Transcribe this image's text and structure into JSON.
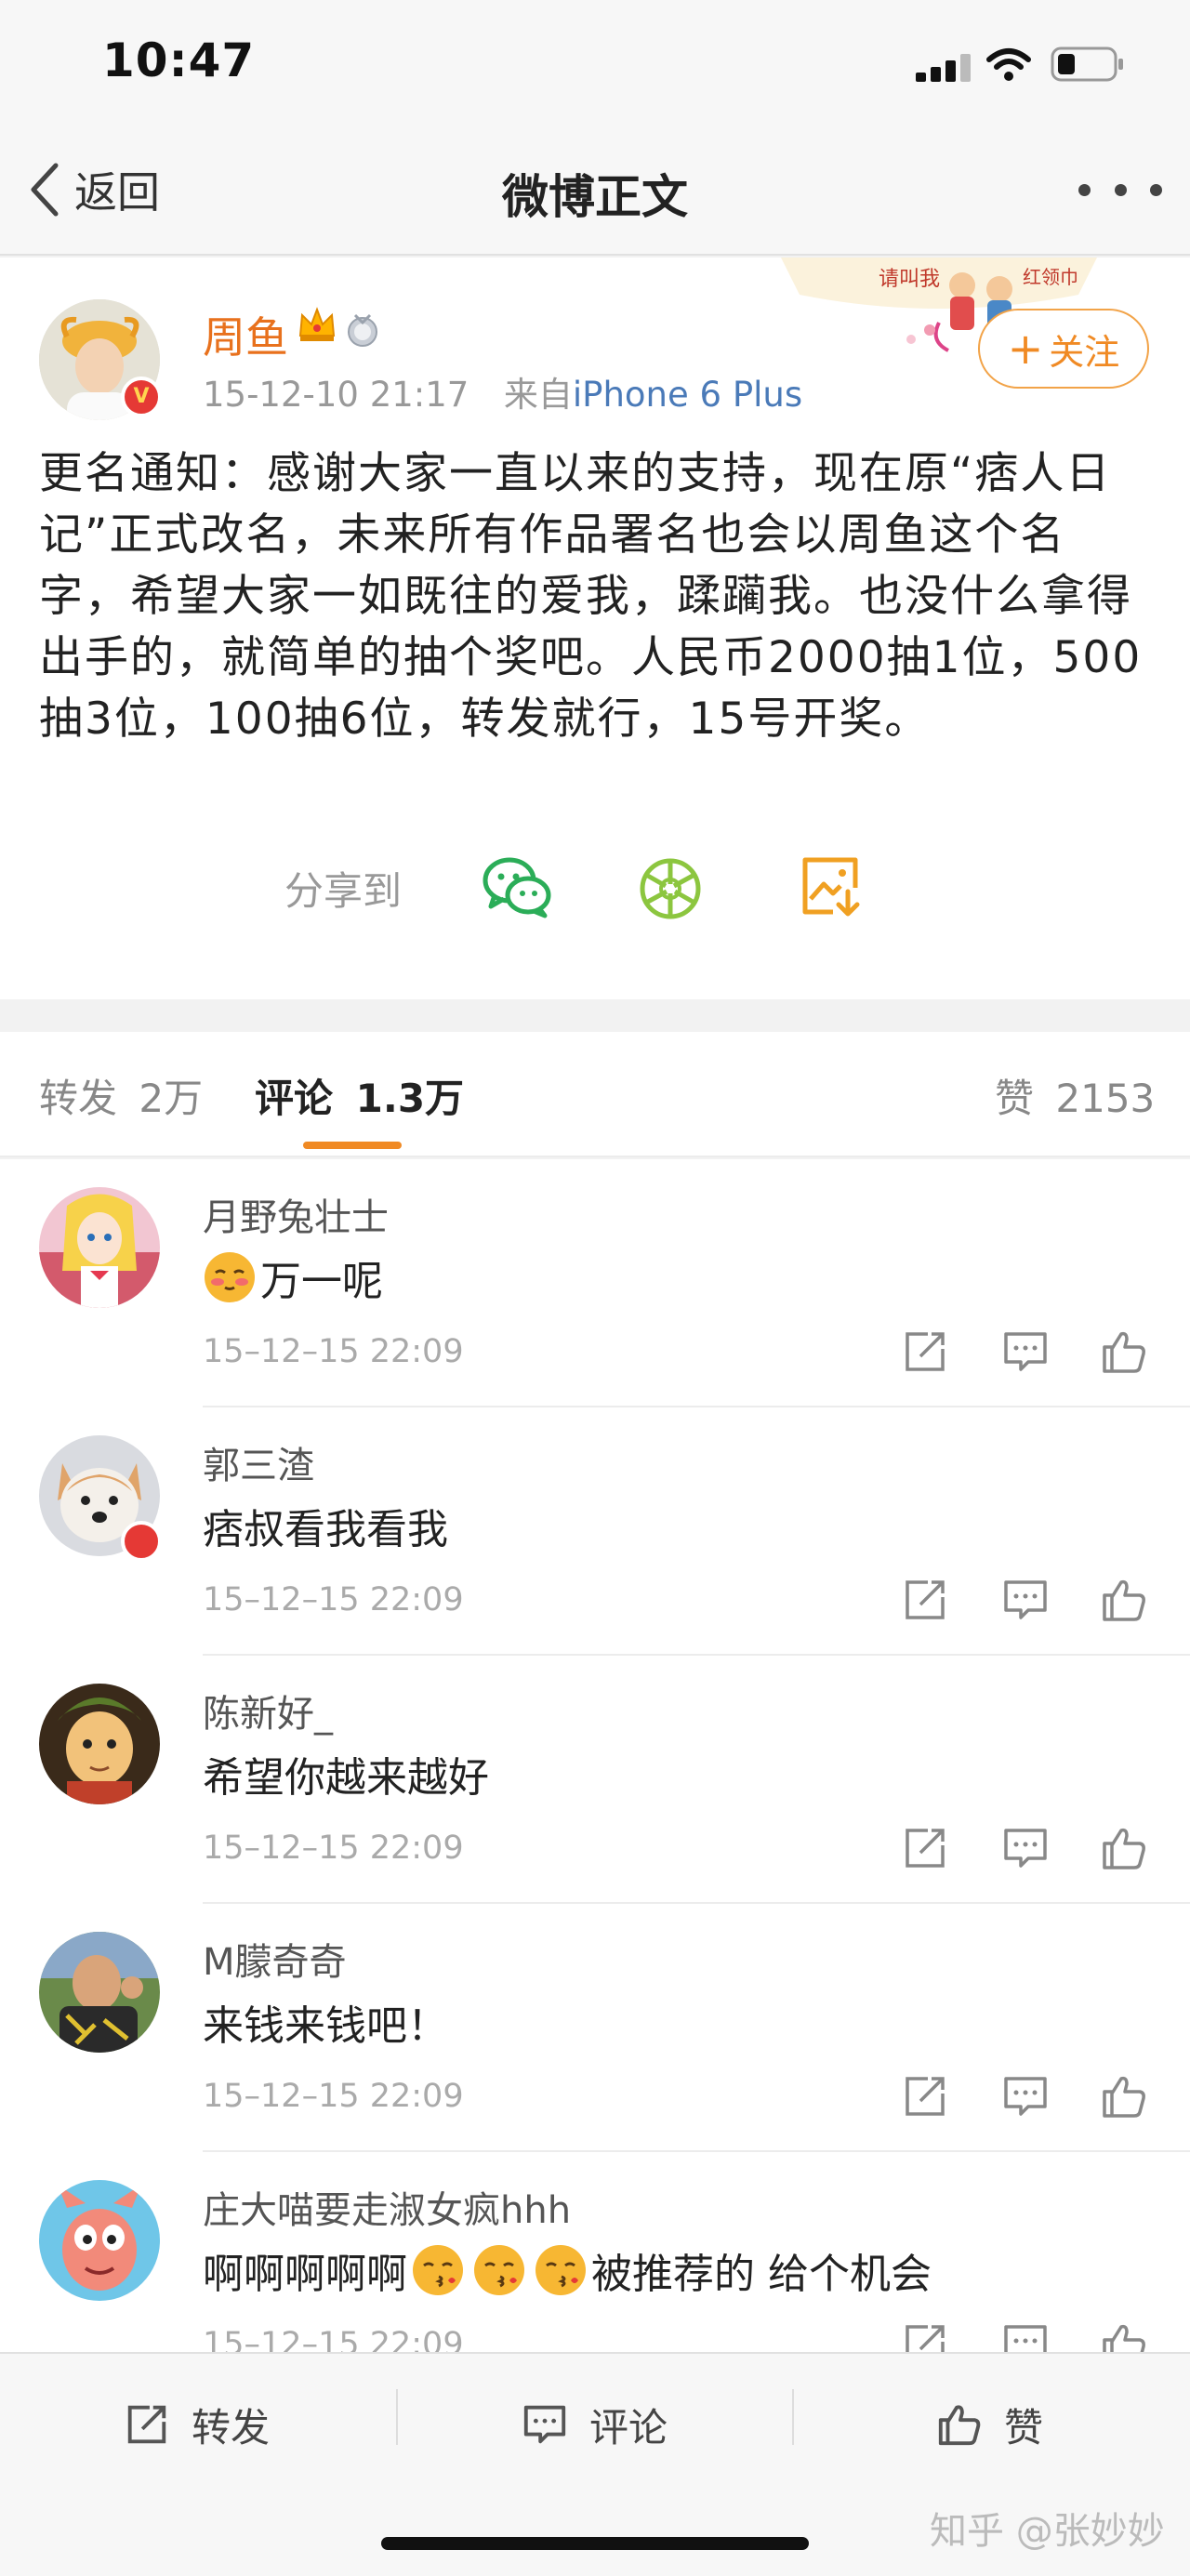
{
  "status_bar": {
    "time": "10:47"
  },
  "nav": {
    "back_label": "返回",
    "title": "微博正文"
  },
  "post": {
    "author": "周鱼",
    "date": "15-12-10 21:17",
    "source_prefix": "来自",
    "source": "iPhone 6 Plus",
    "follow_label": "关注",
    "text": "更名通知：感谢大家一直以来的支持，现在原“痞人日记”正式改名，未来所有作品署名也会以周鱼这个名字，希望大家一如既往的爱我，蹂躏我。也没什么拿得出手的，就简单的抽个奖吧。人民币2000抽1位，500抽3位，100抽6位，转发就行，15号开奖。",
    "share_label": "分享到",
    "share_icons": [
      "wechat-icon",
      "moments-icon",
      "save-image-icon"
    ],
    "banner_text_1": "请叫我",
    "banner_text_2": "红领巾"
  },
  "tabs": {
    "repost_label": "转发",
    "repost_count": "2万",
    "comment_label": "评论",
    "comment_count": "1.3万",
    "like_label": "赞",
    "like_count": "2153"
  },
  "comments": [
    {
      "name": "月野兔壮士",
      "text": "万一呢",
      "time": "15–12–15 22:09"
    },
    {
      "name": "郭三渣",
      "text": "痞叔看我看我",
      "time": "15–12–15 22:09"
    },
    {
      "name": "陈新好_",
      "text": "希望你越来越好",
      "time": "15–12–15 22:09"
    },
    {
      "name": "M朦奇奇",
      "text": "来钱来钱吧！",
      "time": "15–12–15 22:09"
    },
    {
      "name": "庄大喵要走淑女疯hhh",
      "text_a": "啊啊啊啊啊",
      "text_b": "被推荐的 给个机会",
      "time": "15–12–15 22:09"
    }
  ],
  "bottom_bar": {
    "repost": "转发",
    "comment": "评论",
    "like": "赞"
  },
  "watermark": "知乎 @张妙妙",
  "colors": {
    "accent": "#f08a24",
    "author": "#e8711d",
    "link": "#4a7ab8",
    "wechat_green": "#2bad58",
    "moments_green": "#8cc63f",
    "save_orange": "#f0a022"
  }
}
